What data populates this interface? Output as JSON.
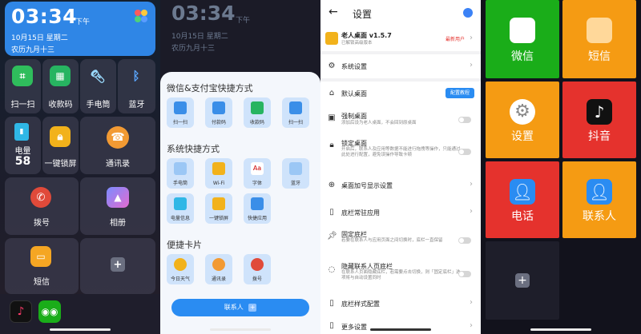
{
  "screen1": {
    "time": "03:34",
    "ampm": "下午",
    "date": "10月15日 星期二",
    "lunar": "农历九月十三",
    "tiles": {
      "scan": "扫一扫",
      "pay_code": "收款码",
      "flashlight": "手电筒",
      "bluetooth": "蓝牙",
      "battery_label": "电量",
      "battery_value": "58",
      "lock": "一键锁屏",
      "contacts": "通讯录",
      "dial": "拨号",
      "album": "相册",
      "sms": "短信",
      "add": "+"
    }
  },
  "screen2": {
    "time": "03:34",
    "ampm": "下午",
    "date": "10月15日 星期二",
    "lunar": "农历九月十三",
    "section1_title": "微信&支付宝快捷方式",
    "section1_items": [
      "扫一扫",
      "付款码",
      "收款码",
      "扫一扫"
    ],
    "section2_title": "系统快捷方式",
    "section2_items": [
      "手电筒",
      "Wi-Fi",
      "字体",
      "蓝牙",
      "电量信息",
      "一键锁屏",
      "快捷应用"
    ],
    "section3_title": "便捷卡片",
    "section3_items": [
      "今日天气",
      "通讯录",
      "拨号"
    ],
    "contact_button": "联系人"
  },
  "screen3": {
    "title": "设置",
    "app_name": "老人桌面 v1.5.7",
    "app_sub": "已解锁高级版本",
    "app_tag": "最新用户",
    "system_settings": "系统设置",
    "default_desktop": "默认桌面",
    "default_desktop_btn": "配置教程",
    "force_desktop": "强制桌面",
    "force_desktop_sub": "添加后设为老人桌面，不会回到原桌面",
    "lock_desktop": "锁定桌面",
    "lock_desktop_sub": "开启后，联系人及应用等数据不能进行拖拽等操作，只能通过此处进行配置，避免误操作导致卡顿",
    "add_display": "桌面加号显示设置",
    "bottom_apps": "底栏常驻应用",
    "fixed_bar": "固定底栏",
    "fixed_bar_sub": "若要在联系人与应用页面之间切换时，底栏一直保留",
    "hide_contact_bar": "隐藏联系人页底栏",
    "hide_contact_bar_sub": "在联系人页面隐藏底栏，若需要点击切换，则「固定底栏」选项将与自动设置同时",
    "bar_style": "底栏样式配置",
    "more": "更多设置"
  },
  "screen4": {
    "wechat": "微信",
    "sms": "短信",
    "settings": "设置",
    "douyin": "抖音",
    "phone": "电话",
    "contacts": "联系人",
    "add": "+"
  },
  "colors": {
    "blue": "#2f86e6",
    "wechat_green": "#1aad19",
    "orange": "#f59b13",
    "red": "#e5322d",
    "sheet_bg": "#f4f7fc",
    "chip_bg": "#cfe3fb"
  }
}
